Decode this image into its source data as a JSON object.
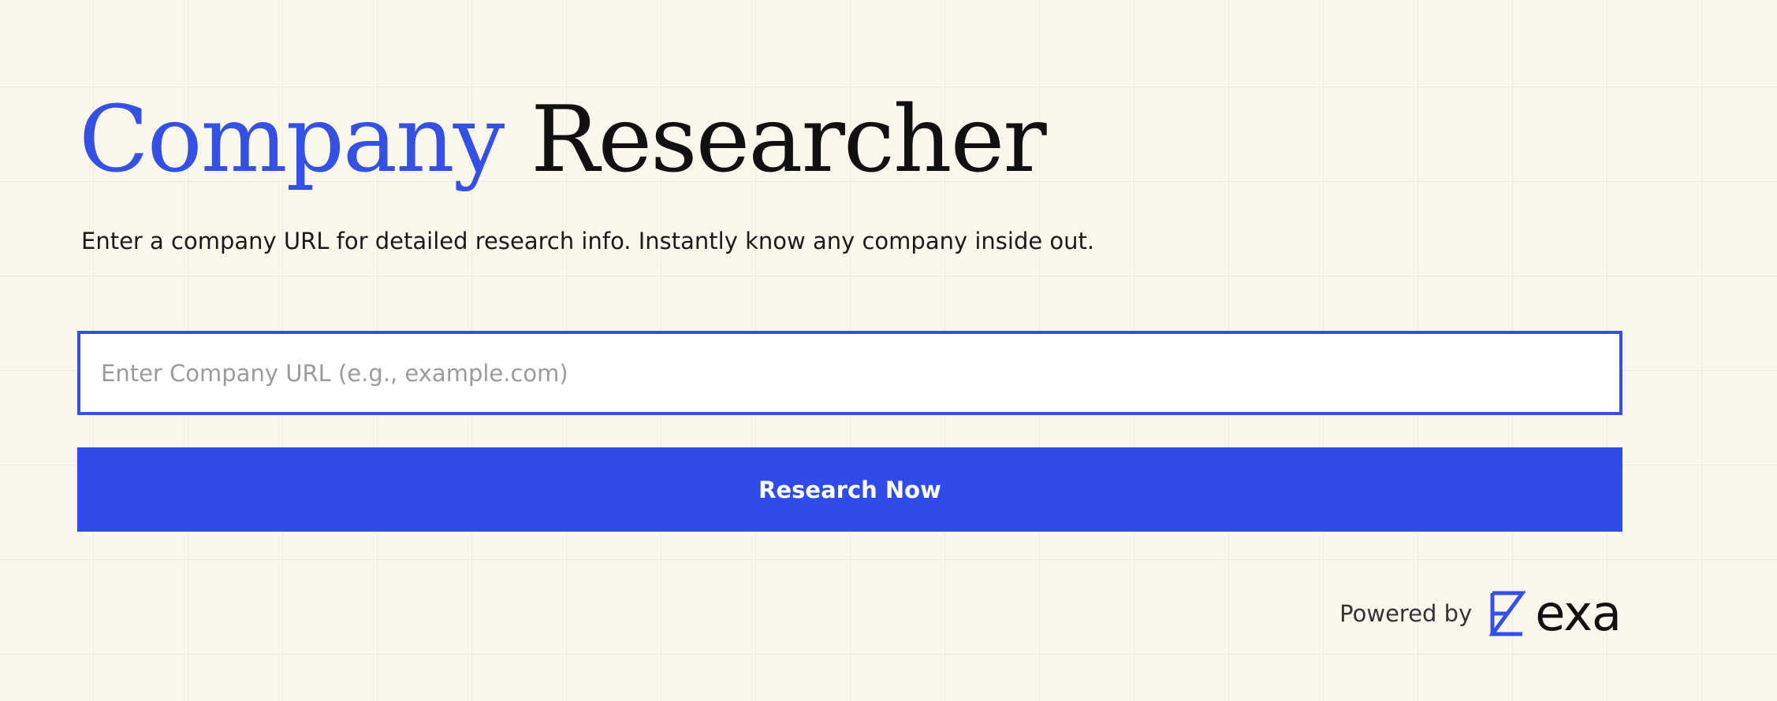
{
  "header": {
    "title_accent": "Company",
    "title_rest": "Researcher",
    "subtitle": "Enter a company URL for detailed research info. Instantly know any company inside out."
  },
  "form": {
    "url_placeholder": "Enter Company URL (e.g., example.com)",
    "url_value": "",
    "submit_label": "Research Now"
  },
  "footer": {
    "powered_by": "Powered by",
    "brand_icon": "exa-logo-icon",
    "brand_name": "exa"
  },
  "colors": {
    "accent": "#3451e4",
    "button": "#2f4ce8",
    "background": "#faf7ed"
  }
}
